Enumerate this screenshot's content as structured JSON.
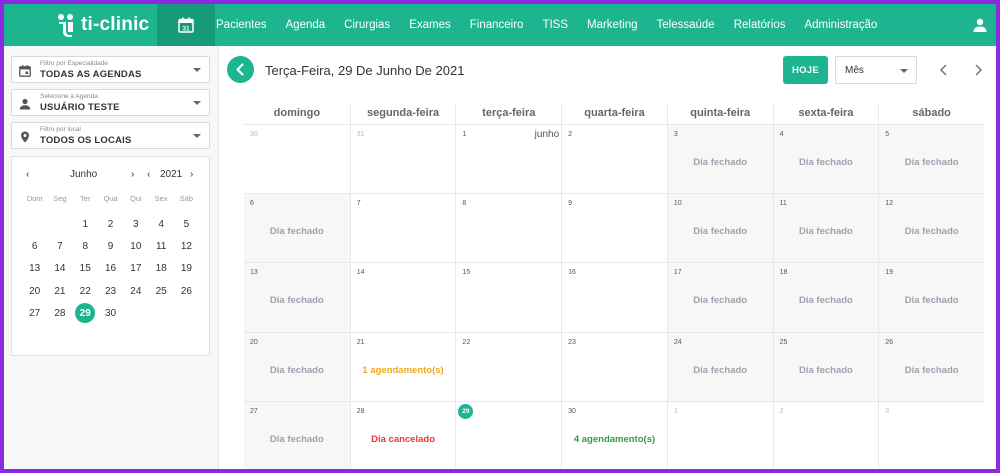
{
  "app": {
    "brand": "ti-clinic"
  },
  "nav": {
    "items": [
      "Pacientes",
      "Agenda",
      "Cirurgias",
      "Exames",
      "Financeiro",
      "TISS",
      "Marketing",
      "Telessaúde",
      "Relatórios",
      "Administração"
    ],
    "calendar_day": "31"
  },
  "sidebar": {
    "filters": [
      {
        "label": "Filtro por Especialidade",
        "value": "TODAS AS AGENDAS",
        "icon": "calendar-icon"
      },
      {
        "label": "Selecione a Agenda",
        "value": "USUÁRIO TESTE",
        "icon": "person-icon"
      },
      {
        "label": "Filtro por local",
        "value": "TODOS OS LOCAIS",
        "icon": "location-pin-icon"
      }
    ],
    "minical": {
      "month": "Junho",
      "year": "2021",
      "weekdays": [
        "Dom",
        "Seg",
        "Ter",
        "Qua",
        "Qui",
        "Sex",
        "Sáb"
      ],
      "days": [
        "",
        "",
        "1",
        "2",
        "3",
        "4",
        "5",
        "6",
        "7",
        "8",
        "9",
        "10",
        "11",
        "12",
        "13",
        "14",
        "15",
        "16",
        "17",
        "18",
        "19",
        "20",
        "21",
        "22",
        "23",
        "24",
        "25",
        "26",
        "27",
        "28",
        "29",
        "30"
      ],
      "selected": "29"
    }
  },
  "toolbar": {
    "date_title": "Terça-Feira, 29 De Junho De 2021",
    "today_label": "HOJE",
    "view_label": "Mês"
  },
  "calendar": {
    "weekdays": [
      "domingo",
      "segunda-feira",
      "terça-feira",
      "quarta-feira",
      "quinta-feira",
      "sexta-feira",
      "sábado"
    ],
    "cells": [
      {
        "day": "30",
        "other": true,
        "closed": false,
        "status": ""
      },
      {
        "day": "31",
        "other": true,
        "closed": false,
        "status": ""
      },
      {
        "day": "1",
        "month_label": "junho",
        "closed": false,
        "status": ""
      },
      {
        "day": "2",
        "closed": false,
        "status": ""
      },
      {
        "day": "3",
        "closed": true,
        "status": "Dia fechado",
        "kind": "closed"
      },
      {
        "day": "4",
        "closed": true,
        "status": "Dia fechado",
        "kind": "closed"
      },
      {
        "day": "5",
        "closed": true,
        "status": "Dia fechado",
        "kind": "closed"
      },
      {
        "day": "6",
        "closed": true,
        "status": "Dia fechado",
        "kind": "closed"
      },
      {
        "day": "7",
        "closed": false,
        "status": ""
      },
      {
        "day": "8",
        "closed": false,
        "status": ""
      },
      {
        "day": "9",
        "closed": false,
        "status": ""
      },
      {
        "day": "10",
        "closed": true,
        "status": "Dia fechado",
        "kind": "closed"
      },
      {
        "day": "11",
        "closed": true,
        "status": "Dia fechado",
        "kind": "closed"
      },
      {
        "day": "12",
        "closed": true,
        "status": "Dia fechado",
        "kind": "closed"
      },
      {
        "day": "13",
        "closed": true,
        "status": "Dia fechado",
        "kind": "closed"
      },
      {
        "day": "14",
        "closed": false,
        "status": ""
      },
      {
        "day": "15",
        "closed": false,
        "status": ""
      },
      {
        "day": "16",
        "closed": false,
        "status": ""
      },
      {
        "day": "17",
        "closed": true,
        "status": "Dia fechado",
        "kind": "closed"
      },
      {
        "day": "18",
        "closed": true,
        "status": "Dia fechado",
        "kind": "closed"
      },
      {
        "day": "19",
        "closed": true,
        "status": "Dia fechado",
        "kind": "closed"
      },
      {
        "day": "20",
        "closed": true,
        "status": "Dia fechado",
        "kind": "closed"
      },
      {
        "day": "21",
        "closed": false,
        "status": "1 agendamento(s)",
        "kind": "pending"
      },
      {
        "day": "22",
        "closed": false,
        "status": ""
      },
      {
        "day": "23",
        "closed": false,
        "status": ""
      },
      {
        "day": "24",
        "closed": true,
        "status": "Dia fechado",
        "kind": "closed"
      },
      {
        "day": "25",
        "closed": true,
        "status": "Dia fechado",
        "kind": "closed"
      },
      {
        "day": "26",
        "closed": true,
        "status": "Dia fechado",
        "kind": "closed"
      },
      {
        "day": "27",
        "closed": true,
        "status": "Dia fechado",
        "kind": "closed"
      },
      {
        "day": "28",
        "closed": false,
        "status": "Dia cancelado",
        "kind": "cancelled"
      },
      {
        "day": "29",
        "today": true,
        "closed": false,
        "status": ""
      },
      {
        "day": "30",
        "closed": false,
        "status": "4 agendamento(s)",
        "kind": "booked"
      },
      {
        "day": "1",
        "other": true,
        "closed": false,
        "status": ""
      },
      {
        "day": "2",
        "other": true,
        "closed": false,
        "status": ""
      },
      {
        "day": "3",
        "other": true,
        "closed": false,
        "status": ""
      }
    ]
  },
  "colors": {
    "accent": "#1cb58f",
    "closed_text": "#9aa3ad",
    "pending_text": "#f2a81d",
    "cancelled_text": "#e53935",
    "booked_text": "#2e9e44"
  }
}
